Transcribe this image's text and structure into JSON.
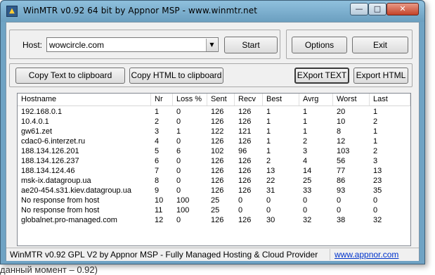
{
  "window": {
    "title": "WinMTR v0.92 64 bit by Appnor MSP - www.winmtr.net",
    "min_glyph": "—",
    "max_glyph": "□",
    "close_glyph": "✕"
  },
  "host": {
    "label": "Host:",
    "value": "wowcircle.com"
  },
  "buttons": {
    "start": "Start",
    "options": "Options",
    "exit": "Exit",
    "copy_text": "Copy Text to clipboard",
    "copy_html": "Copy HTML to clipboard",
    "export_text": "EXport TEXT",
    "export_html": "Export HTML"
  },
  "table": {
    "columns": [
      "Hostname",
      "Nr",
      "Loss %",
      "Sent",
      "Recv",
      "Best",
      "Avrg",
      "Worst",
      "Last"
    ],
    "rows": [
      [
        "192.168.0.1",
        "1",
        "0",
        "126",
        "126",
        "1",
        "1",
        "20",
        "1"
      ],
      [
        "10.4.0.1",
        "2",
        "0",
        "126",
        "126",
        "1",
        "1",
        "10",
        "2"
      ],
      [
        "gw61.zet",
        "3",
        "1",
        "122",
        "121",
        "1",
        "1",
        "8",
        "1"
      ],
      [
        "cdac0-6.interzet.ru",
        "4",
        "0",
        "126",
        "126",
        "1",
        "2",
        "12",
        "1"
      ],
      [
        "188.134.126.201",
        "5",
        "6",
        "102",
        "96",
        "1",
        "3",
        "103",
        "2"
      ],
      [
        "188.134.126.237",
        "6",
        "0",
        "126",
        "126",
        "2",
        "4",
        "56",
        "3"
      ],
      [
        "188.134.124.46",
        "7",
        "0",
        "126",
        "126",
        "13",
        "14",
        "77",
        "13"
      ],
      [
        "msk-ix.datagroup.ua",
        "8",
        "0",
        "126",
        "126",
        "22",
        "25",
        "86",
        "23"
      ],
      [
        "ae20-454.s31.kiev.datagroup.ua",
        "9",
        "0",
        "126",
        "126",
        "31",
        "33",
        "93",
        "35"
      ],
      [
        "No response from host",
        "10",
        "100",
        "25",
        "0",
        "0",
        "0",
        "0",
        "0"
      ],
      [
        "No response from host",
        "11",
        "100",
        "25",
        "0",
        "0",
        "0",
        "0",
        "0"
      ],
      [
        "globalnet.pro-managed.com",
        "12",
        "0",
        "126",
        "126",
        "30",
        "32",
        "38",
        "32"
      ]
    ]
  },
  "status": {
    "text": "WinMTR v0.92 GPL V2 by Appnor MSP - Fully Managed Hosting & Cloud Provider",
    "link": "www.appnor.com"
  },
  "background": {
    "text": "данный момент – 0.92)"
  },
  "icons": [
    "app-icon",
    "minimize-icon",
    "maximize-icon",
    "close-icon",
    "dropdown-arrow-icon"
  ]
}
